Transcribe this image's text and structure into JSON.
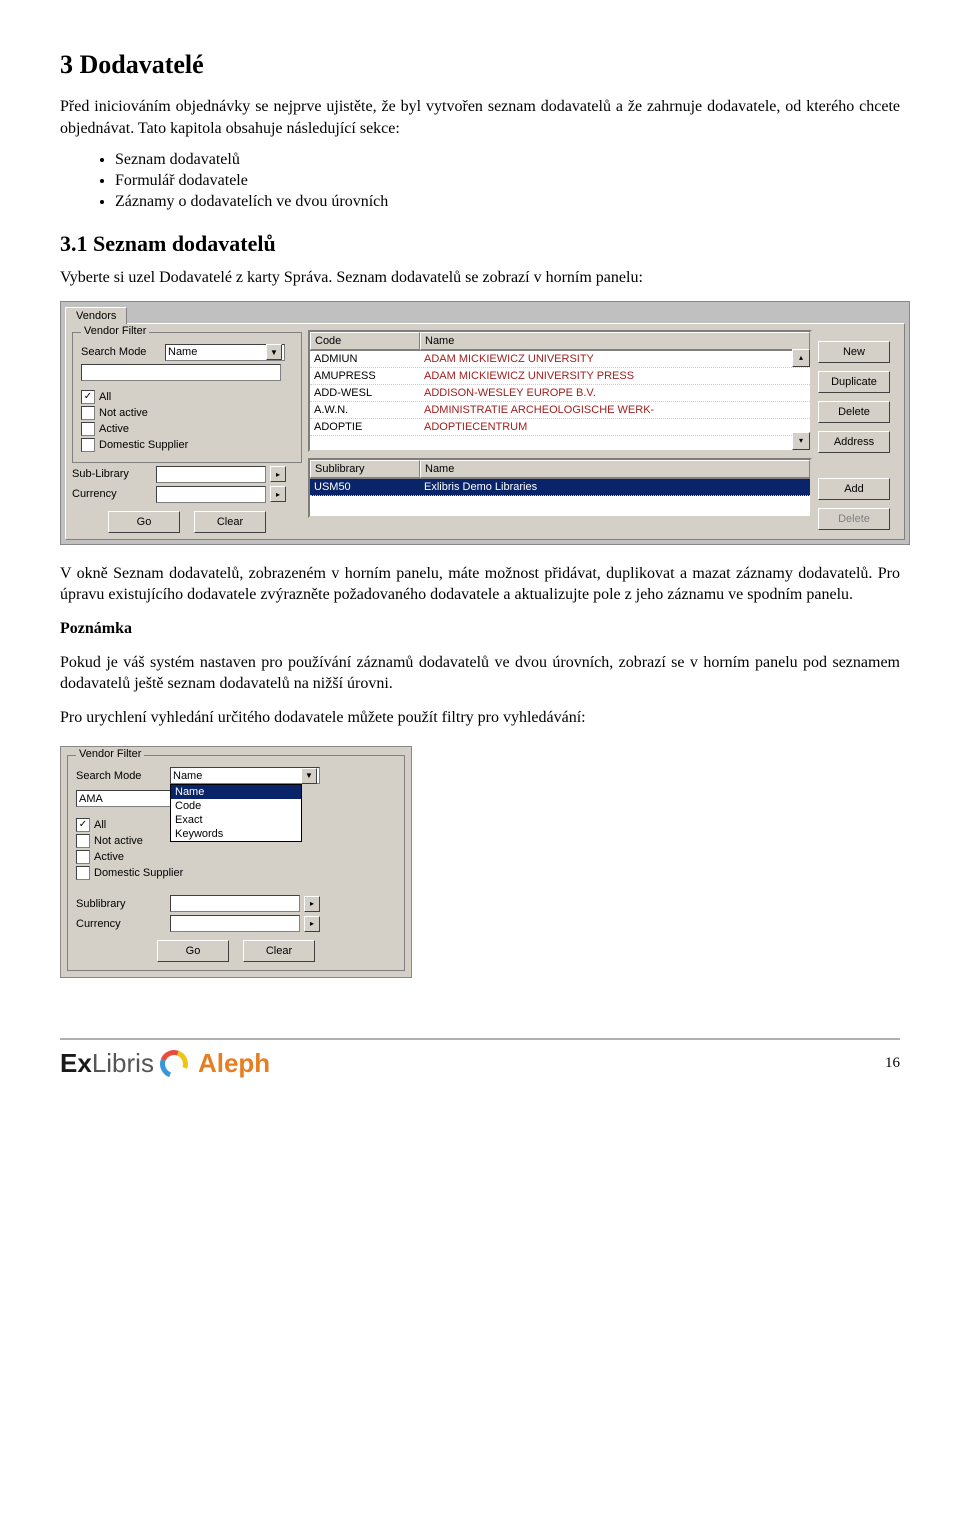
{
  "heading1": "3   Dodavatelé",
  "intro_p1": "Před iniciováním objednávky se nejprve ujistěte, že byl vytvořen seznam dodavatelů a že zahrnuje dodavatele, od kterého chcete objednávat. Tato kapitola obsahuje následující sekce:",
  "bullets": [
    "Seznam dodavatelů",
    "Formulář dodavatele",
    "Záznamy o dodavatelích ve dvou úrovních"
  ],
  "heading2": "3.1  Seznam dodavatelů",
  "p2": "Vyberte si uzel Dodavatelé z karty Správa. Seznam dodavatelů se zobrazí v horním panelu:",
  "p3": "V okně Seznam dodavatelů, zobrazeném v horním panelu, máte možnost přidávat, duplikovat a mazat záznamy dodavatelů. Pro úpravu existujícího dodavatele zvýrazněte požadovaného dodavatele a aktualizujte pole z jeho záznamu ve spodním panelu.",
  "note_title": "Poznámka",
  "note_p": "Pokud je váš systém nastaven pro používání záznamů dodavatelů ve dvou úrovních, zobrazí se v horním panelu pod seznamem dodavatelů ještě seznam dodavatelů na nižší úrovni.",
  "p4": "Pro urychlení vyhledání určitého dodavatele můžete použít filtry pro vyhledávání:",
  "ss1": {
    "tab": "Vendors",
    "group_title": "Vendor Filter",
    "labels": {
      "search_mode": "Search Mode",
      "sub_library": "Sub-Library",
      "currency": "Currency",
      "sublibrary_hdr": "Sublibrary",
      "name_hdr": "Name",
      "code_hdr": "Code"
    },
    "search_mode_value": "Name",
    "checks": [
      {
        "label": "All",
        "checked": true
      },
      {
        "label": "Not active",
        "checked": false
      },
      {
        "label": "Active",
        "checked": false
      },
      {
        "label": "Domestic Supplier",
        "checked": false
      }
    ],
    "buttons": {
      "go": "Go",
      "clear": "Clear"
    },
    "side_buttons": [
      "New",
      "Duplicate",
      "Delete",
      "Address",
      "Add",
      "Delete"
    ],
    "vendor_rows": [
      {
        "code": "ADMIUN",
        "name": "ADAM MICKIEWICZ UNIVERSITY"
      },
      {
        "code": "AMUPRESS",
        "name": "ADAM MICKIEWICZ UNIVERSITY PRESS"
      },
      {
        "code": "ADD-WESL",
        "name": "ADDISON-WESLEY EUROPE B.V."
      },
      {
        "code": "A.W.N.",
        "name": "ADMINISTRATIE ARCHEOLOGISCHE WERK-"
      },
      {
        "code": "ADOPTIE",
        "name": "ADOPTIECENTRUM"
      }
    ],
    "sublib_rows": [
      {
        "code": "USM50",
        "name": "Exlibris Demo Libraries"
      }
    ]
  },
  "ss2": {
    "group_title": "Vendor Filter",
    "search_mode_label": "Search Mode",
    "input_value": "AMA",
    "options": [
      "Name",
      "Code",
      "Exact",
      "Keywords"
    ],
    "checks": [
      {
        "label": "All",
        "checked": true
      },
      {
        "label": "Not active",
        "checked": false
      },
      {
        "label": "Active",
        "checked": false
      },
      {
        "label": "Domestic Supplier",
        "checked": false
      }
    ],
    "sublibrary_label": "Sublibrary",
    "currency_label": "Currency",
    "buttons": {
      "go": "Go",
      "clear": "Clear"
    }
  },
  "footer": {
    "brand1": "Ex",
    "brand2": "Libris",
    "brand3": "Aleph",
    "page": "16"
  }
}
